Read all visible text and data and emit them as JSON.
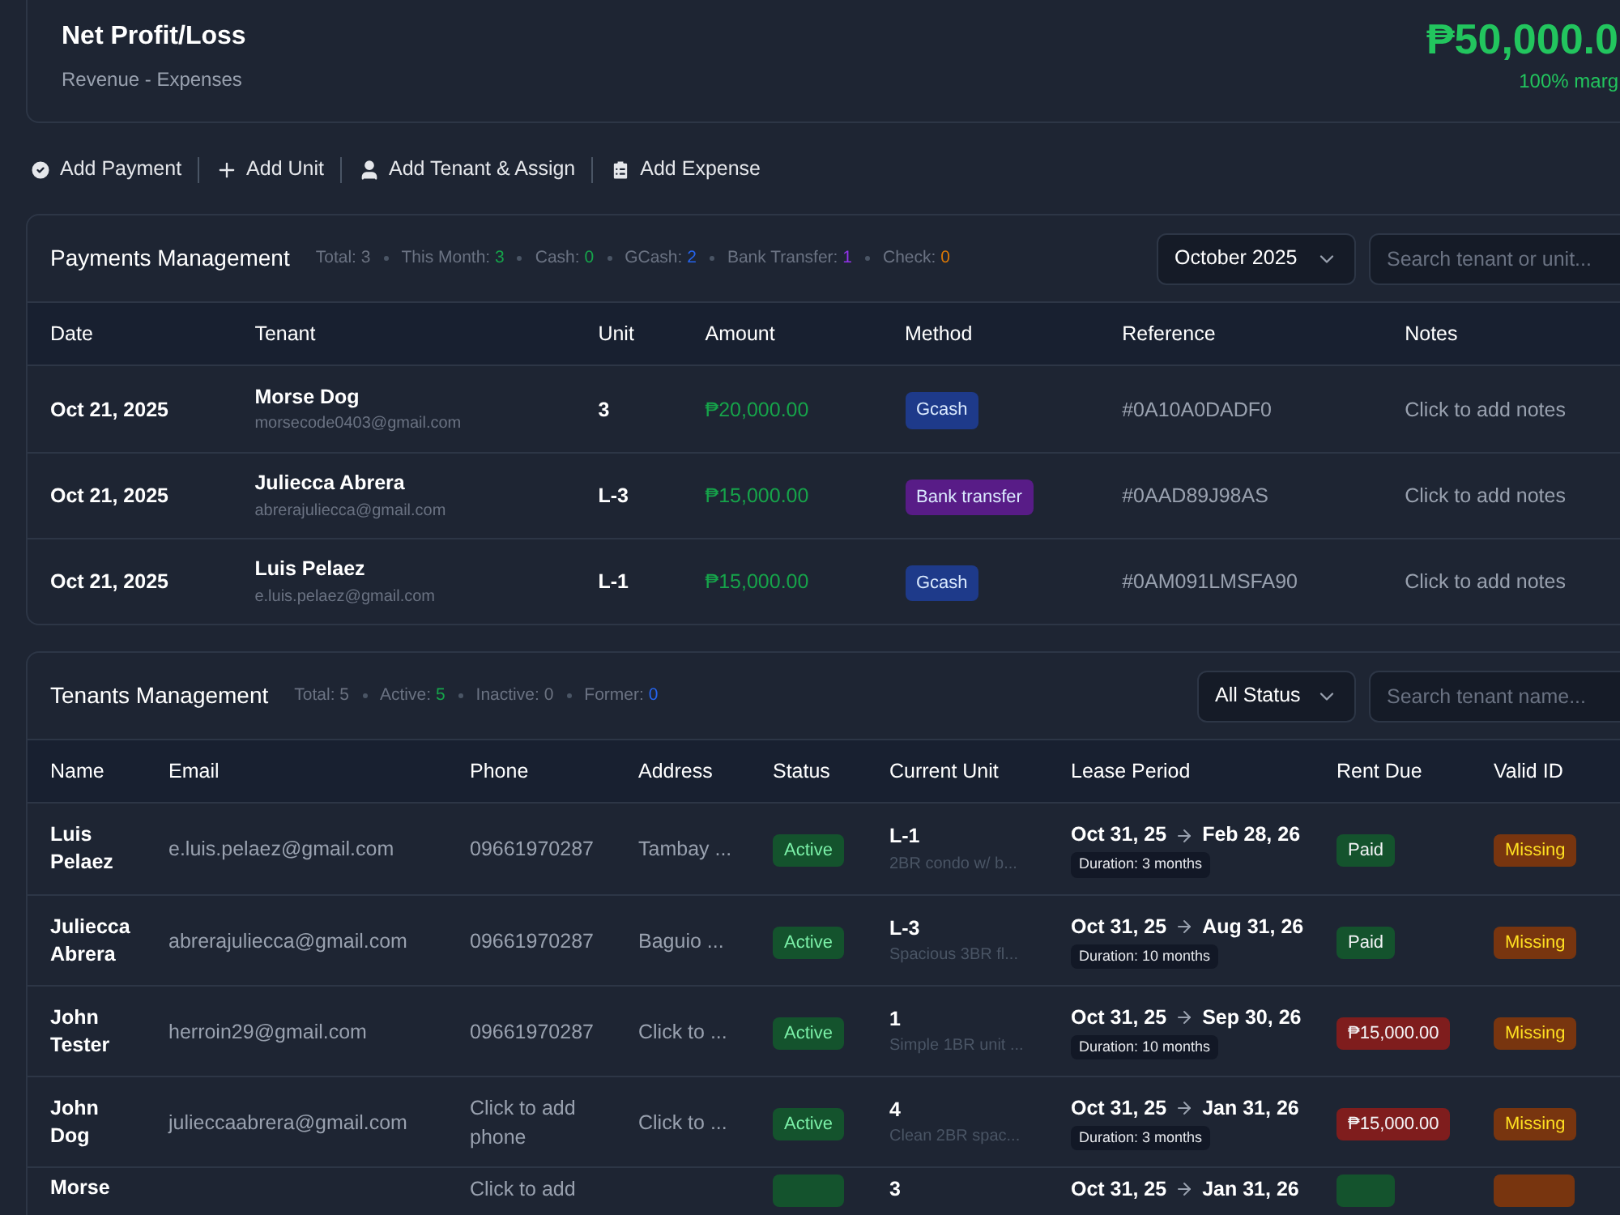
{
  "summary": {
    "title": "Net Profit/Loss",
    "subtitle": "Revenue - Expenses",
    "value": "₱50,000.0",
    "note": "100% marg"
  },
  "actions": [
    {
      "kind": "check",
      "label": "Add Payment"
    },
    {
      "kind": "plus",
      "label": "Add Unit"
    },
    {
      "kind": "user",
      "label": "Add Tenant & Assign"
    },
    {
      "kind": "clipboard",
      "label": "Add Expense"
    }
  ],
  "payments": {
    "title": "Payments Management",
    "stats": [
      {
        "label": "Total:",
        "value": "3",
        "color": "#6b7280"
      },
      {
        "label": "This Month:",
        "value": "3",
        "color": "#16a34a"
      },
      {
        "label": "Cash:",
        "value": "0",
        "color": "#16a34a"
      },
      {
        "label": "GCash:",
        "value": "2",
        "color": "#2563eb"
      },
      {
        "label": "Bank Transfer:",
        "value": "1",
        "color": "#9333ea"
      },
      {
        "label": "Check:",
        "value": "0",
        "color": "#d97706"
      }
    ],
    "month_select": "October 2025",
    "search": {
      "placeholder": "Search tenant or unit..."
    },
    "columns": [
      "Date",
      "Tenant",
      "Unit",
      "Amount",
      "Method",
      "Reference",
      "Notes"
    ],
    "rows": [
      {
        "date": "Oct 21, 2025",
        "tenant": "Morse Dog",
        "email": "morsecode0403@gmail.com",
        "unit": "3",
        "amount": "₱20,000.00",
        "method": {
          "label": "Gcash",
          "color": "#1e3a8a"
        },
        "reference": "#0A10A0DADF0",
        "notes": "Click to add notes"
      },
      {
        "date": "Oct 21, 2025",
        "tenant": "Juliecca Abrera",
        "email": "abrerajuliecca@gmail.com",
        "unit": "L-3",
        "amount": "₱15,000.00",
        "method": {
          "label": "Bank transfer",
          "color": "#581c87"
        },
        "reference": "#0AAD89J98AS",
        "notes": "Click to add notes"
      },
      {
        "date": "Oct 21, 2025",
        "tenant": "Luis Pelaez",
        "email": "e.luis.pelaez@gmail.com",
        "unit": "L-1",
        "amount": "₱15,000.00",
        "method": {
          "label": "Gcash",
          "color": "#1e3a8a"
        },
        "reference": "#0AM091LMSFA90",
        "notes": "Click to add notes"
      }
    ]
  },
  "tenants": {
    "title": "Tenants Management",
    "stats": [
      {
        "label": "Total:",
        "value": "5",
        "color": "#6b7280"
      },
      {
        "label": "Active:",
        "value": "5",
        "color": "#16a34a"
      },
      {
        "label": "Inactive:",
        "value": "0",
        "color": "#6b7280"
      },
      {
        "label": "Former:",
        "value": "0",
        "color": "#2563eb"
      }
    ],
    "status_select": "All Status",
    "search": {
      "placeholder": "Search tenant name..."
    },
    "columns": [
      "Name",
      "Email",
      "Phone",
      "Address",
      "Status",
      "Current Unit",
      "Lease Period",
      "Rent Due",
      "Valid ID"
    ],
    "rows": [
      {
        "name": "Luis Pelaez",
        "email": "e.luis.pelaez@gmail.com",
        "phone": "09661970287",
        "address": "Tambay ...",
        "status": {
          "label": "Active",
          "color": "#14532d"
        },
        "unit": "L-1",
        "unit_desc": "2BR condo w/ b...",
        "lease_start": "Oct 31, 25",
        "lease_end": "Feb 28, 26",
        "duration": "Duration: 3 months",
        "rent_due": {
          "label": "Paid",
          "color": "#14532d"
        },
        "valid_id": {
          "label": "Missing",
          "color": "#78350f"
        }
      },
      {
        "name": "Juliecca Abrera",
        "email": "abrerajuliecca@gmail.com",
        "phone": "09661970287",
        "address": "Baguio ...",
        "status": {
          "label": "Active",
          "color": "#14532d"
        },
        "unit": "L-3",
        "unit_desc": "Spacious 3BR fl...",
        "lease_start": "Oct 31, 25",
        "lease_end": "Aug 31, 26",
        "duration": "Duration: 10 months",
        "rent_due": {
          "label": "Paid",
          "color": "#14532d"
        },
        "valid_id": {
          "label": "Missing",
          "color": "#78350f"
        }
      },
      {
        "name": "John Tester",
        "email": "herroin29@gmail.com",
        "phone": "09661970287",
        "address": "Click to ...",
        "status": {
          "label": "Active",
          "color": "#14532d"
        },
        "unit": "1",
        "unit_desc": "Simple 1BR unit ...",
        "lease_start": "Oct 31, 25",
        "lease_end": "Sep 30, 26",
        "duration": "Duration: 10 months",
        "rent_due": {
          "label": "₱15,000.00",
          "color": "#7f1d1d"
        },
        "valid_id": {
          "label": "Missing",
          "color": "#78350f"
        }
      },
      {
        "name": "John Dog",
        "email": "julieccaabrera@gmail.com",
        "phone": "Click to add phone",
        "address": "Click to ...",
        "status": {
          "label": "Active",
          "color": "#14532d"
        },
        "unit": "4",
        "unit_desc": "Clean 2BR spac...",
        "lease_start": "Oct 31, 25",
        "lease_end": "Jan 31, 26",
        "duration": "Duration: 3 months",
        "rent_due": {
          "label": "₱15,000.00",
          "color": "#7f1d1d"
        },
        "valid_id": {
          "label": "Missing",
          "color": "#78350f"
        }
      },
      {
        "name": "Morse",
        "phone": "Click to add",
        "status": {
          "color": "#14532d"
        },
        "unit": "3",
        "lease_start": "Oct 31, 25",
        "lease_end": "Jan 31, 26",
        "rent_due": {
          "color": "#14532d"
        },
        "valid_id": {
          "color": "#78350f"
        }
      }
    ]
  }
}
